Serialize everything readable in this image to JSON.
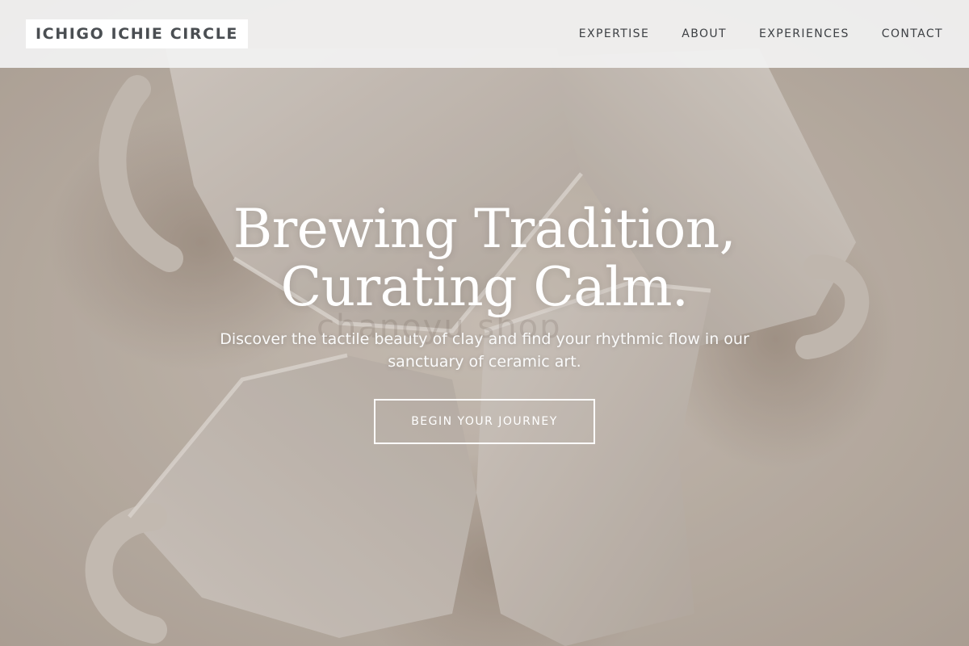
{
  "brand": {
    "logo_text": "ICHIGO ICHIE CIRCLE"
  },
  "nav": {
    "items": [
      {
        "label": "EXPERTISE"
      },
      {
        "label": "ABOUT"
      },
      {
        "label": "EXPERIENCES"
      },
      {
        "label": "CONTACT"
      }
    ]
  },
  "hero": {
    "title_line1": "Brewing Tradition,",
    "title_line2": "Curating Calm.",
    "subtitle": "Discover the tactile beauty of clay and find your rhythmic flow in our sanctuary of ceramic art.",
    "cta_label": "BEGIN YOUR JOURNEY",
    "watermark_text": "chanoyu shop",
    "background_image": "ceramic-cups-photo"
  },
  "colors": {
    "header_bg": "#f2f2f2",
    "logo_bg": "#ffffff",
    "nav_text": "#3d4044",
    "hero_text": "#ffffff",
    "hero_bg": "#c9bfb6"
  }
}
